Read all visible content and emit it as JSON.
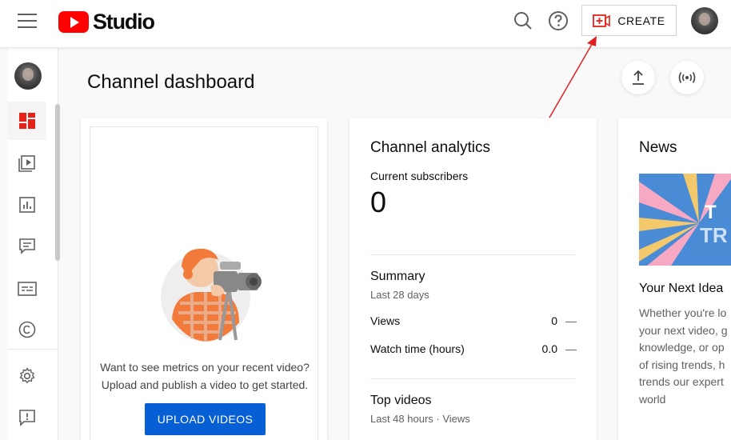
{
  "header": {
    "logo_text": "Studio",
    "create_label": "CREATE"
  },
  "page": {
    "title": "Channel dashboard"
  },
  "upload_card": {
    "line1": "Want to see metrics on your recent video?",
    "line2": "Upload and publish a video to get started.",
    "button_label": "UPLOAD VIDEOS"
  },
  "analytics": {
    "title": "Channel analytics",
    "subscribers_label": "Current subscribers",
    "subscribers_value": "0",
    "summary_title": "Summary",
    "summary_period": "Last 28 days",
    "rows": [
      {
        "label": "Views",
        "value": "0",
        "trend": "—"
      },
      {
        "label": "Watch time (hours)",
        "value": "0.0",
        "trend": "—"
      }
    ],
    "top_videos_title": "Top videos",
    "top_videos_period": "Last 48 hours · Views"
  },
  "news": {
    "title": "News",
    "headline": "Your Next Idea",
    "body": [
      "Whether you're lo",
      "your next video, g",
      "knowledge, or op",
      "of rising trends, h",
      "trends our expert",
      "world"
    ],
    "image_text": [
      "T",
      "TR"
    ]
  },
  "colors": {
    "brand_red": "#ff0000",
    "primary_blue": "#065fd4",
    "annotation_arrow": "#e02020"
  }
}
